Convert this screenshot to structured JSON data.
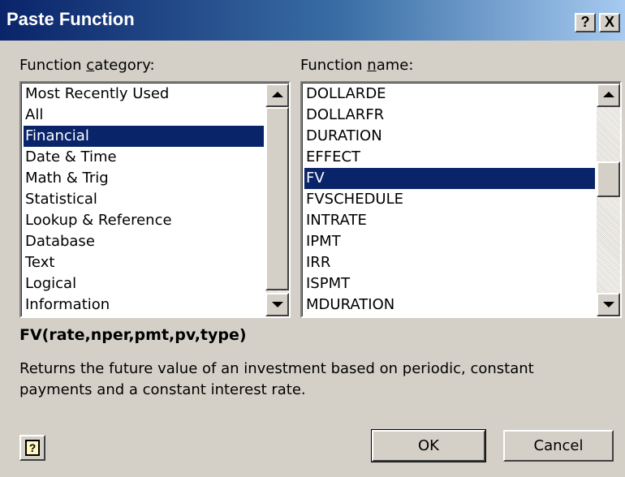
{
  "dialog": {
    "title": "Paste Function",
    "help_glyph": "?",
    "close_glyph": "X"
  },
  "category": {
    "label_pre": "Function ",
    "label_ul": "c",
    "label_post": "ategory:",
    "items": [
      "Most Recently Used",
      "All",
      "Financial",
      "Date & Time",
      "Math & Trig",
      "Statistical",
      "Lookup & Reference",
      "Database",
      "Text",
      "Logical",
      "Information"
    ],
    "selected": "Financial"
  },
  "function": {
    "label_pre": "Function ",
    "label_ul": "n",
    "label_post": "ame:",
    "items": [
      "DOLLARDE",
      "DOLLARFR",
      "DURATION",
      "EFFECT",
      "FV",
      "FVSCHEDULE",
      "INTRATE",
      "IPMT",
      "IRR",
      "ISPMT",
      "MDURATION"
    ],
    "selected": "FV"
  },
  "syntax": "FV(rate,nper,pmt,pv,type)",
  "description": "Returns the future value of an investment based on periodic, constant payments and a constant interest rate.",
  "buttons": {
    "ok": "OK",
    "cancel": "Cancel",
    "help_glyph": "?"
  },
  "colors": {
    "title_bar": "#0a246a",
    "selection": "#0a246a",
    "face": "#d4d0c8"
  }
}
